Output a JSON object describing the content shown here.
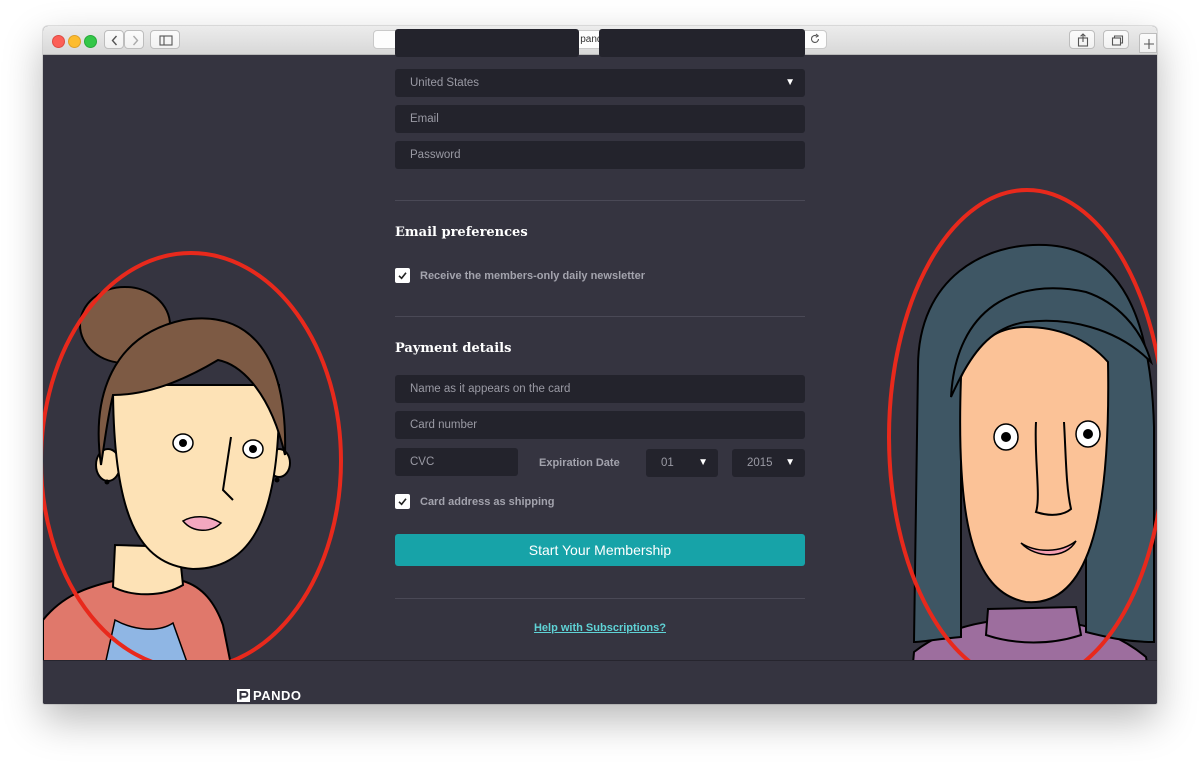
{
  "browser": {
    "url": "pando.com"
  },
  "form": {
    "country": "United States",
    "email_placeholder": "Email",
    "password_placeholder": "Password",
    "email_prefs_heading": "Email preferences",
    "newsletter_label": "Receive the members-only daily newsletter",
    "payment_heading": "Payment details",
    "card_name_placeholder": "Name as it appears on the card",
    "card_number_placeholder": "Card number",
    "cvc_placeholder": "CVC",
    "expiration_label": "Expiration Date",
    "exp_month": "01",
    "exp_year": "2015",
    "shipping_label": "Card address as shipping",
    "submit_label": "Start Your Membership",
    "help_link": "Help with Subscriptions?"
  },
  "footer": {
    "logo_text": "PANDO"
  },
  "colors": {
    "page_bg": "#353440",
    "field_bg": "#23232c",
    "accent": "#17a3a8",
    "link": "#5fd3d6",
    "annotation": "#e8291c"
  },
  "icons": [
    "back-icon",
    "forward-icon",
    "sidebar-icon",
    "lock-icon",
    "reload-icon",
    "share-icon",
    "tabs-icon",
    "plus-icon",
    "checkmark-icon",
    "pando-logo-icon",
    "dropdown-caret-icon"
  ]
}
